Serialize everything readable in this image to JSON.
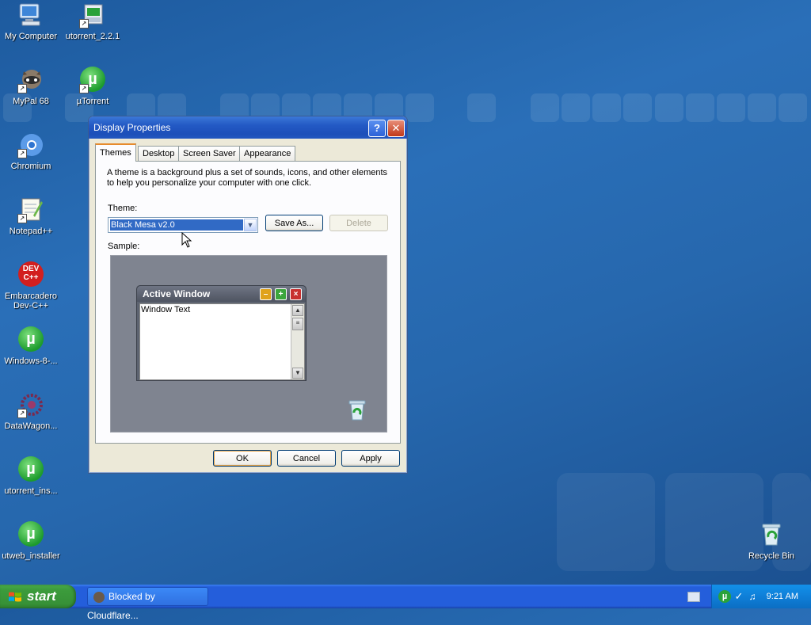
{
  "desktop": {
    "icons": [
      {
        "label": "My Computer"
      },
      {
        "label": "utorrent_2.2.1"
      },
      {
        "label": "MyPal 68"
      },
      {
        "label": "µTorrent"
      },
      {
        "label": "Chromium"
      },
      {
        "label": "Notepad++"
      },
      {
        "label": "Embarcadero Dev-C++"
      },
      {
        "label": "Windows-8-..."
      },
      {
        "label": "DataWagon..."
      },
      {
        "label": "utorrent_ins..."
      },
      {
        "label": "utweb_installer"
      },
      {
        "label": "Recycle Bin"
      }
    ],
    "dev_badge": "DEV",
    "dev_badge_sub": "C++"
  },
  "dialog": {
    "title": "Display Properties",
    "help_glyph": "?",
    "close_glyph": "✕",
    "tabs": [
      {
        "label": "Themes",
        "active": true
      },
      {
        "label": "Desktop"
      },
      {
        "label": "Screen Saver"
      },
      {
        "label": "Appearance"
      }
    ],
    "description": "A theme is a background plus a set of sounds, icons, and other elements to help you personalize your computer with one click.",
    "theme_label": "Theme:",
    "theme_value": "Black Mesa v2.0",
    "save_as_label": "Save As...",
    "delete_label": "Delete",
    "sample_label": "Sample:",
    "sample": {
      "window_title": "Active Window",
      "window_text": "Window Text"
    },
    "ok_label": "OK",
    "cancel_label": "Cancel",
    "apply_label": "Apply"
  },
  "taskbar": {
    "start_label": "start",
    "task_label": "Blocked by Cloudflare...",
    "clock": "9:21 AM"
  },
  "colors": {
    "desktop": "#2a6fb8",
    "titlebar": "#2359c4",
    "selection": "#316ac5",
    "start": "#3c9c3c"
  }
}
